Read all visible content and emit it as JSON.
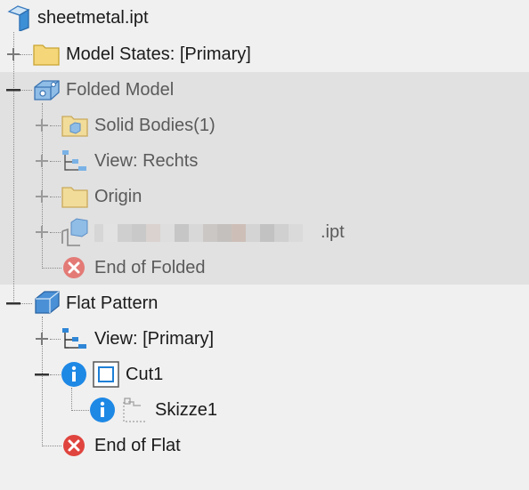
{
  "tree": {
    "root": {
      "label": "sheetmetal.ipt",
      "icon": "part-file-icon"
    },
    "model_states": {
      "label": "Model States: [Primary]",
      "icon": "folder-icon"
    },
    "folded_model": {
      "label": "Folded Model",
      "icon": "folded-model-icon",
      "children": {
        "solid_bodies": {
          "label": "Solid Bodies(1)",
          "icon": "solid-bodies-folder-icon"
        },
        "view": {
          "label": "View: Rechts",
          "icon": "view-icon"
        },
        "origin": {
          "label": "Origin",
          "icon": "folder-icon"
        },
        "derived_part": {
          "label_suffix": ".ipt",
          "icon": "derived-part-icon"
        },
        "end": {
          "label": "End of Folded",
          "icon": "end-of-part-icon"
        }
      }
    },
    "flat_pattern": {
      "label": "Flat Pattern",
      "icon": "flat-pattern-icon",
      "children": {
        "view": {
          "label": "View: [Primary]",
          "icon": "view-icon"
        },
        "cut1": {
          "label": "Cut1",
          "icon": "cut-icon",
          "children": {
            "sketch": {
              "label": "Skizze1",
              "icon": "sketch-icon"
            }
          }
        },
        "end": {
          "label": "End of Flat",
          "icon": "end-of-part-icon"
        }
      }
    }
  },
  "colors": {
    "highlight": "#e1e1e1",
    "info_blue": "#1e88e5",
    "end_red": "#e0443e",
    "folder_yellow": "#f5d77a"
  }
}
